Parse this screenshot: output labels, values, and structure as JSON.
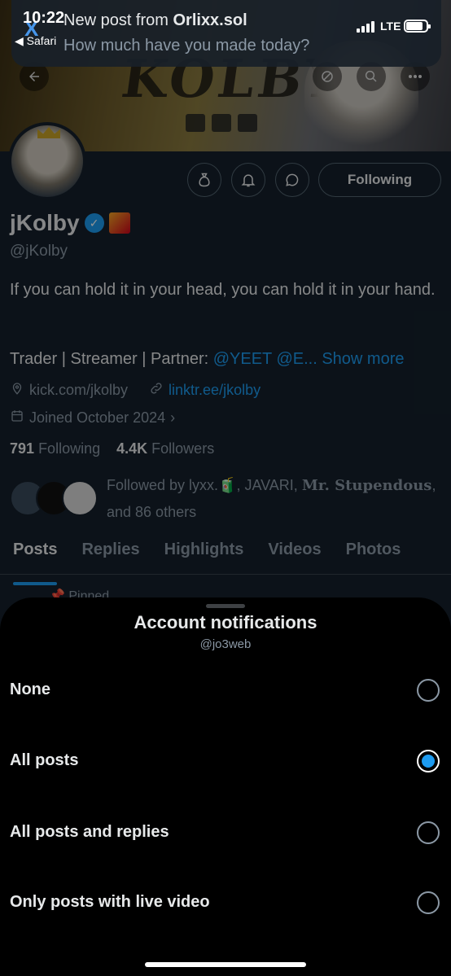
{
  "status_bar": {
    "time": "10:22",
    "back_label": "◀ Safari",
    "network": "LTE"
  },
  "notification": {
    "title_prefix": "New post from ",
    "title_name": "Orlixx.sol",
    "body": "How much have you made today?"
  },
  "profile": {
    "banner_text": "KOLBY",
    "following_button": "Following",
    "name": "jKolby",
    "handle": "@jKolby",
    "bio": "If you can hold it in your head, you can hold it in your hand.",
    "bio_line2_prefix": "Trader | Streamer | Partner: ",
    "bio_line2_links": "@YEET @E...",
    "show_more": "Show more",
    "website1": "kick.com/jkolby",
    "website2": "linktr.ee/jkolby",
    "joined": "Joined October 2024",
    "following_count": "791",
    "following_label": "Following",
    "followers_count": "4.4K",
    "followers_label": "Followers",
    "followed_by_prefix": "Followed by lyxx.🧃, JAVARI, ",
    "followed_by_bold": "Mr. Stupendous",
    "followed_by_suffix": ", and 86 others",
    "tabs": [
      {
        "label": "Posts",
        "active": true
      },
      {
        "label": "Replies",
        "active": false
      },
      {
        "label": "Highlights",
        "active": false
      },
      {
        "label": "Videos",
        "active": false
      },
      {
        "label": "Photos",
        "active": false
      }
    ],
    "pinned": "Pinned"
  },
  "sheet": {
    "title": "Account notifications",
    "subtitle": "@jo3web",
    "options": [
      {
        "label": "None",
        "selected": false
      },
      {
        "label": "All posts",
        "selected": true
      },
      {
        "label": "All posts and replies",
        "selected": false
      },
      {
        "label": "Only posts with live video",
        "selected": false
      }
    ]
  },
  "colors": {
    "accent": "#1d9bf0",
    "sheet_bg": "#000000",
    "profile_bg": "#15202b",
    "muted_text": "#8b98a5"
  },
  "icons": [
    "back-arrow-icon",
    "search-icon",
    "more-icon",
    "money-bag-icon",
    "bell-icon",
    "message-icon",
    "location-icon",
    "link-icon",
    "calendar-icon",
    "chevron-right-icon",
    "verified-icon",
    "pin-icon"
  ]
}
